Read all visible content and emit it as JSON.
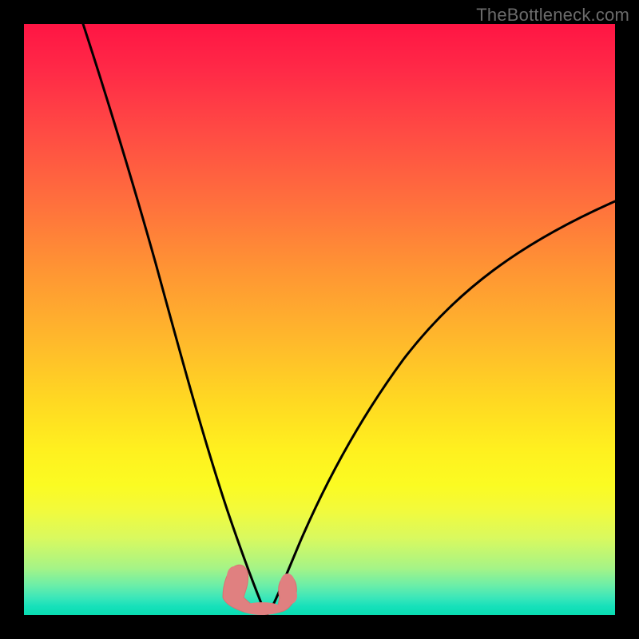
{
  "watermark": "TheBottleneck.com",
  "chart_data": {
    "type": "line",
    "title": "",
    "xlabel": "",
    "ylabel": "",
    "xlim": [
      0,
      100
    ],
    "ylim": [
      0,
      100
    ],
    "grid": false,
    "legend": false,
    "series": [
      {
        "name": "left-curve",
        "x": [
          10,
          12,
          16,
          20,
          24,
          28,
          30,
          32,
          33.5,
          35,
          36,
          37.5,
          38.5,
          39.2,
          39.8,
          40.2,
          40.6
        ],
        "y": [
          100,
          92,
          78,
          64,
          50,
          36,
          28,
          20,
          14,
          8,
          5,
          2,
          1,
          0.5,
          0.2,
          0.1,
          0
        ]
      },
      {
        "name": "right-curve",
        "x": [
          40.6,
          42.5,
          44,
          46,
          48,
          52,
          56,
          62,
          70,
          80,
          90,
          100
        ],
        "y": [
          0,
          2,
          5,
          9,
          14,
          23,
          31,
          40,
          50,
          59,
          65,
          70
        ]
      },
      {
        "name": "blob-outline",
        "x": [
          33.5,
          34,
          35.5,
          38,
          41,
          43.3,
          44.5,
          44.8,
          44.4,
          43,
          41,
          38,
          35.5,
          34,
          33.5
        ],
        "y": [
          3,
          6,
          8.5,
          9.2,
          9,
          8,
          6,
          3,
          1.5,
          0.7,
          0.3,
          0.3,
          0.7,
          1.5,
          3
        ]
      }
    ],
    "gradient_colors": {
      "top": "#ff1544",
      "upper_mid": "#ff9633",
      "mid": "#fff01f",
      "lower": "#6beea8",
      "bottom": "#09dcb2"
    }
  }
}
